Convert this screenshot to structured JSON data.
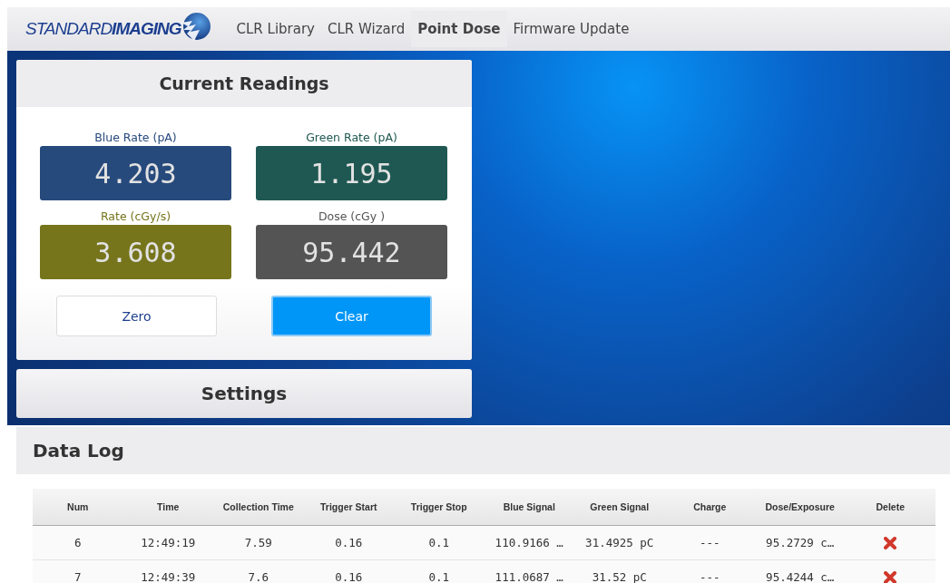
{
  "logo": {
    "text": "STANDARD**IMAGING**"
  },
  "nav": [
    {
      "label": "CLR Library",
      "selected": false
    },
    {
      "label": "CLR Wizard",
      "selected": false
    },
    {
      "label": "Point Dose",
      "selected": true
    },
    {
      "label": "Firmware Update",
      "selected": false
    }
  ],
  "current_readings": {
    "title": "Current Readings",
    "readouts": [
      {
        "label": "Blue Rate (pA)",
        "value": "4.203",
        "color": "#274a7c"
      },
      {
        "label": "Green Rate (pA)",
        "value": "1.195",
        "color": "#1f5852"
      },
      {
        "label": "Rate (cGy/s)",
        "value": "3.608",
        "color": "#76751c"
      },
      {
        "label": "Dose (cGy )",
        "value": "95.442",
        "color": "#545454"
      }
    ],
    "buttons": [
      {
        "label": "Zero",
        "kind": "default"
      },
      {
        "label": "Clear",
        "kind": "primary"
      }
    ]
  },
  "settings": {
    "title": "Settings"
  },
  "data_log": {
    "title": "Data Log",
    "columns": [
      "Num",
      "Time",
      "Collection Time",
      "Trigger Start",
      "Trigger Stop",
      "Blue Signal",
      "Green Signal",
      "Charge",
      "Dose/Exposure",
      "Delete"
    ],
    "rows": [
      [
        "6",
        "12:49:19",
        "7.59",
        "0.16",
        "0.1",
        "110.9166 …",
        "31.4925 pC",
        "---",
        "95.2729 c…"
      ],
      [
        "7",
        "12:49:39",
        "7.6",
        "0.16",
        "0.1",
        "111.0687 …",
        "31.52 pC",
        "---",
        "95.4244 c…"
      ]
    ]
  }
}
